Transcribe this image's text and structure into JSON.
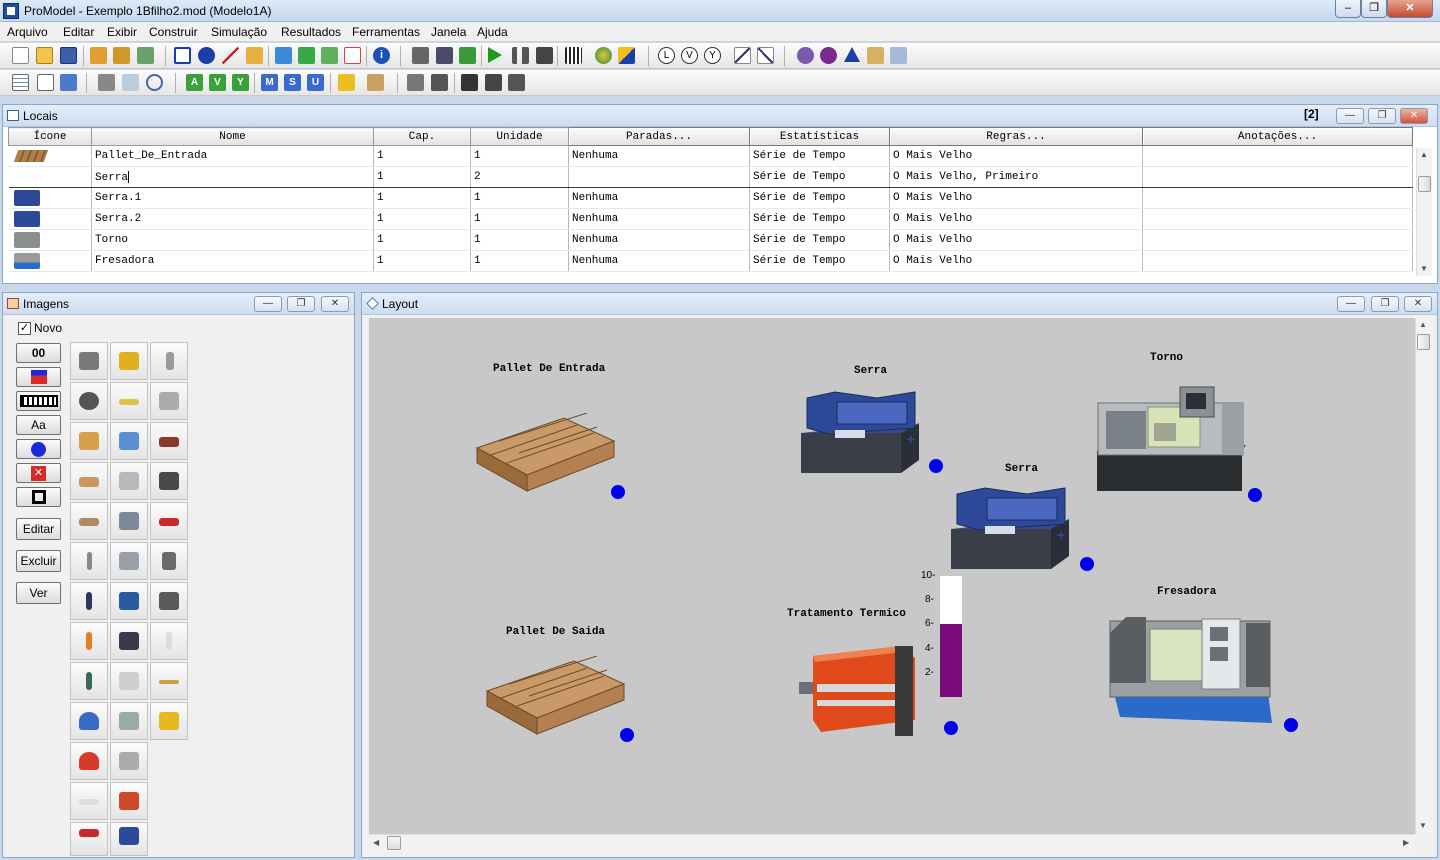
{
  "window": {
    "title": "ProModel - Exemplo 1Bfilho2.mod (Modelo1A)"
  },
  "menu": [
    "Arquivo",
    "Editar",
    "Exibir",
    "Construir",
    "Simulação",
    "Resultados",
    "Ferramentas",
    "Janela",
    "Ajuda"
  ],
  "locais": {
    "title": "Locais",
    "badge": "[2]",
    "headers": {
      "icone": "Ícone",
      "nome": "Nome",
      "cap": "Cap.",
      "unidade": "Unidade",
      "paradas": "Paradas...",
      "estatisticas": "Estatísticas",
      "regras": "Regras...",
      "anotacoes": "Anotações..."
    },
    "rows": [
      {
        "nome": "Pallet_De_Entrada",
        "cap": "1",
        "unidade": "1",
        "paradas": "Nenhuma",
        "estat": "Série de Tempo",
        "regras": "O Mais Velho"
      },
      {
        "nome": "Serra",
        "cap": "1",
        "unidade": "2",
        "paradas": "",
        "estat": "Série de Tempo",
        "regras": "O Mais Velho, Primeiro"
      },
      {
        "nome": "Serra.1",
        "cap": "1",
        "unidade": "1",
        "paradas": "Nenhuma",
        "estat": "Série de Tempo",
        "regras": "O Mais Velho"
      },
      {
        "nome": "Serra.2",
        "cap": "1",
        "unidade": "1",
        "paradas": "Nenhuma",
        "estat": "Série de Tempo",
        "regras": "O Mais Velho"
      },
      {
        "nome": "Torno",
        "cap": "1",
        "unidade": "1",
        "paradas": "Nenhuma",
        "estat": "Série de Tempo",
        "regras": "O Mais Velho"
      },
      {
        "nome": "Fresadora",
        "cap": "1",
        "unidade": "1",
        "paradas": "Nenhuma",
        "estat": "Série de Tempo",
        "regras": "O Mais Velho"
      }
    ]
  },
  "imagens": {
    "title": "Imagens",
    "novo": "Novo",
    "b00": "00",
    "aa": "Aa",
    "editar": "Editar",
    "excluir": "Excluir",
    "ver": "Ver"
  },
  "layout": {
    "title": "Layout",
    "labels": {
      "pallet_entrada": "Pallet De Entrada",
      "serra_top": "Serra",
      "torno": "Torno",
      "serra_mid": "Serra",
      "fresadora": "Fresadora",
      "tratamento": "Tratamento Termico",
      "pallet_saida": "Pallet De Saida"
    },
    "gauge": {
      "ticks": [
        "10-",
        "8-",
        "6-",
        "4-",
        "2-"
      ],
      "level": 0.6
    }
  }
}
